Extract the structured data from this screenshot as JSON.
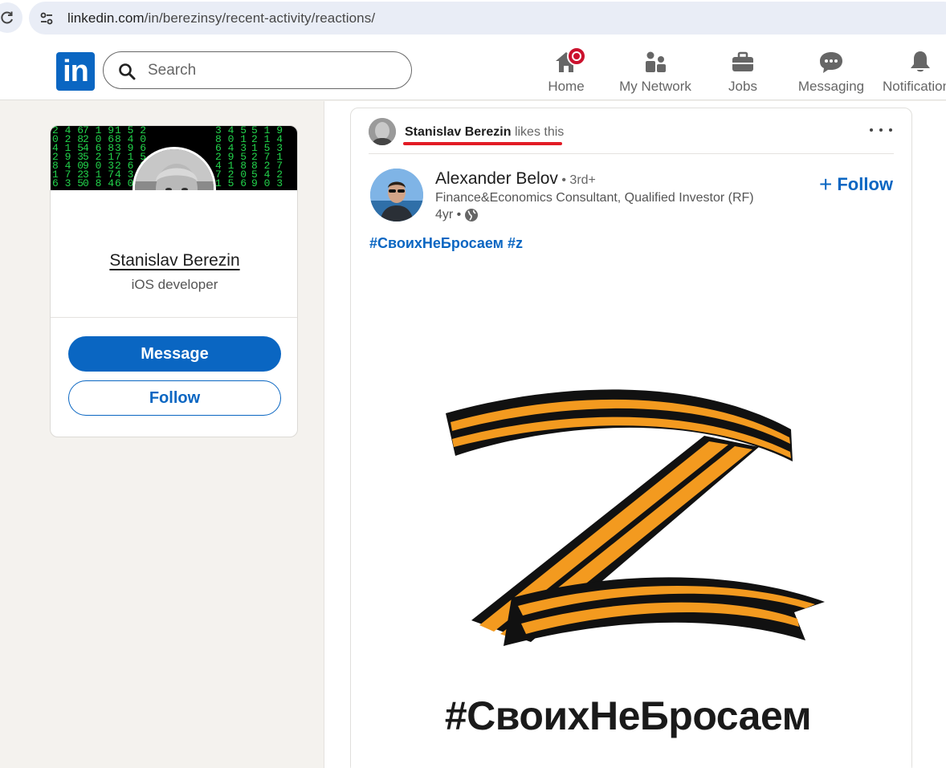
{
  "browser": {
    "url_host": "linkedin.com",
    "url_path": "/in/berezinsy/recent-activity/reactions/"
  },
  "nav": {
    "logo": "in",
    "search_placeholder": "Search",
    "items": [
      {
        "label": "Home",
        "icon": "home-icon",
        "has_badge": true
      },
      {
        "label": "My Network",
        "icon": "network-icon"
      },
      {
        "label": "Jobs",
        "icon": "briefcase-icon"
      },
      {
        "label": "Messaging",
        "icon": "messaging-icon"
      },
      {
        "label": "Notifications",
        "icon": "bell-icon"
      }
    ]
  },
  "profile": {
    "name": "Stanislav Berezin",
    "headline": "iOS developer",
    "message_label": "Message",
    "follow_label": "Follow"
  },
  "post": {
    "liker_name": "Stanislav Berezin",
    "liker_action": " likes this",
    "author_name": "Alexander Belov",
    "author_degree": " • 3rd+",
    "author_headline": "Finance&Economics Consultant, Qualified Investor (RF)",
    "time": "4yr •",
    "follow_label": "Follow",
    "hashtags": "#СвоихНеБросаем #z",
    "image_caption": "#СвоихНеБросаем"
  },
  "colors": {
    "brand": "#0a66c2",
    "badge": "#cb112d",
    "highlight_underline": "#e21b25",
    "ribbon_orange": "#f39a1f",
    "ribbon_black": "#111111"
  }
}
